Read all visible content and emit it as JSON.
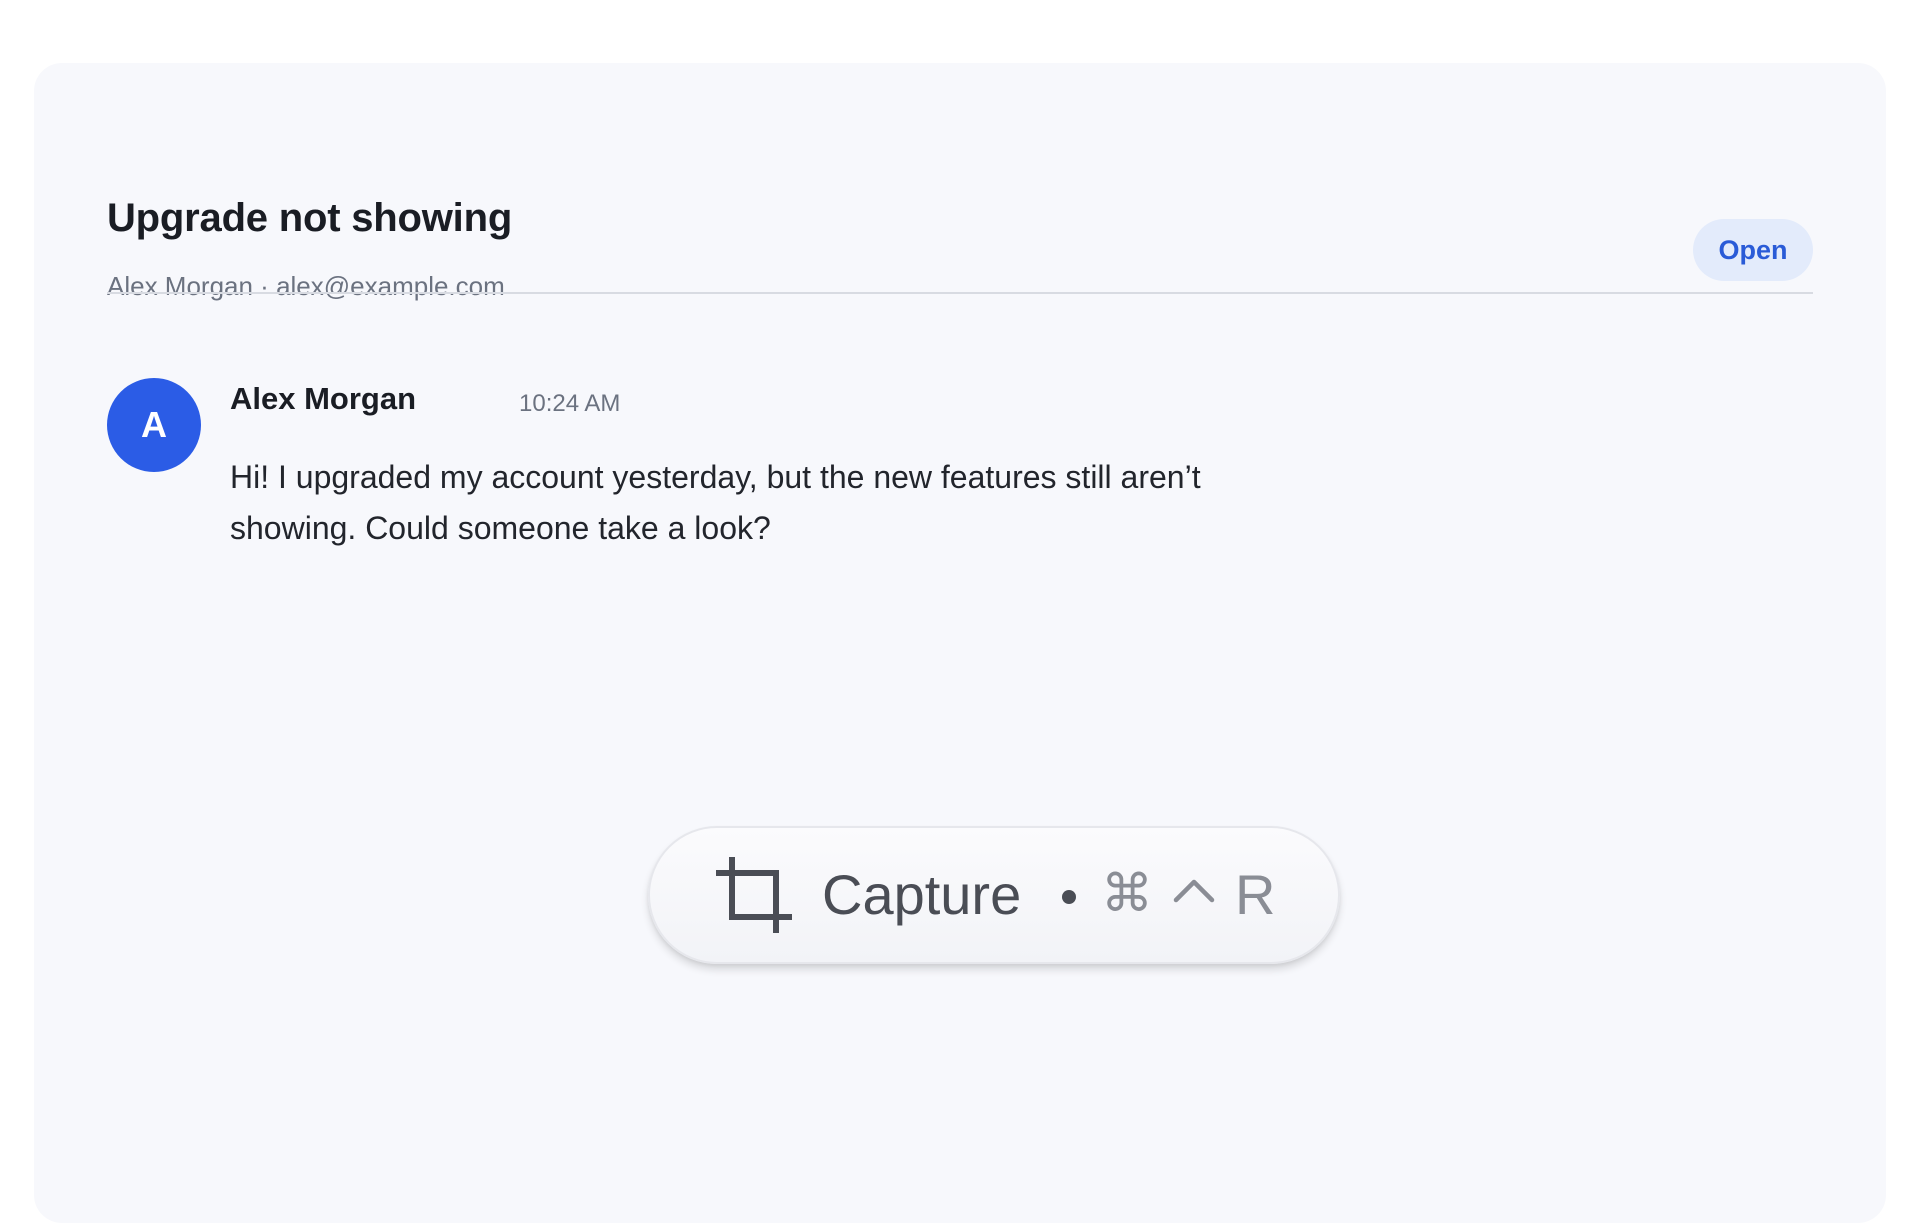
{
  "ticket": {
    "title": "Upgrade not showing",
    "meta": "Alex Morgan · alex@example.com",
    "status": "Open"
  },
  "message": {
    "avatar_initial": "A",
    "author": "Alex Morgan",
    "time": "10:24 AM",
    "body": "Hi! I upgraded my account yesterday, but the new features still aren’t showing. Could someone take a look?"
  },
  "capture_overlay": {
    "icon": "crop-icon",
    "label": "Capture",
    "shortcut_cmd": "⌘",
    "shortcut_ctrl_icon": "control-key-icon",
    "shortcut_key": "R"
  },
  "colors": {
    "accent": "#2b5ce6",
    "badge_bg": "#e3ebfb",
    "badge_text": "#2a5bd7",
    "card_bg": "#f7f8fc"
  }
}
